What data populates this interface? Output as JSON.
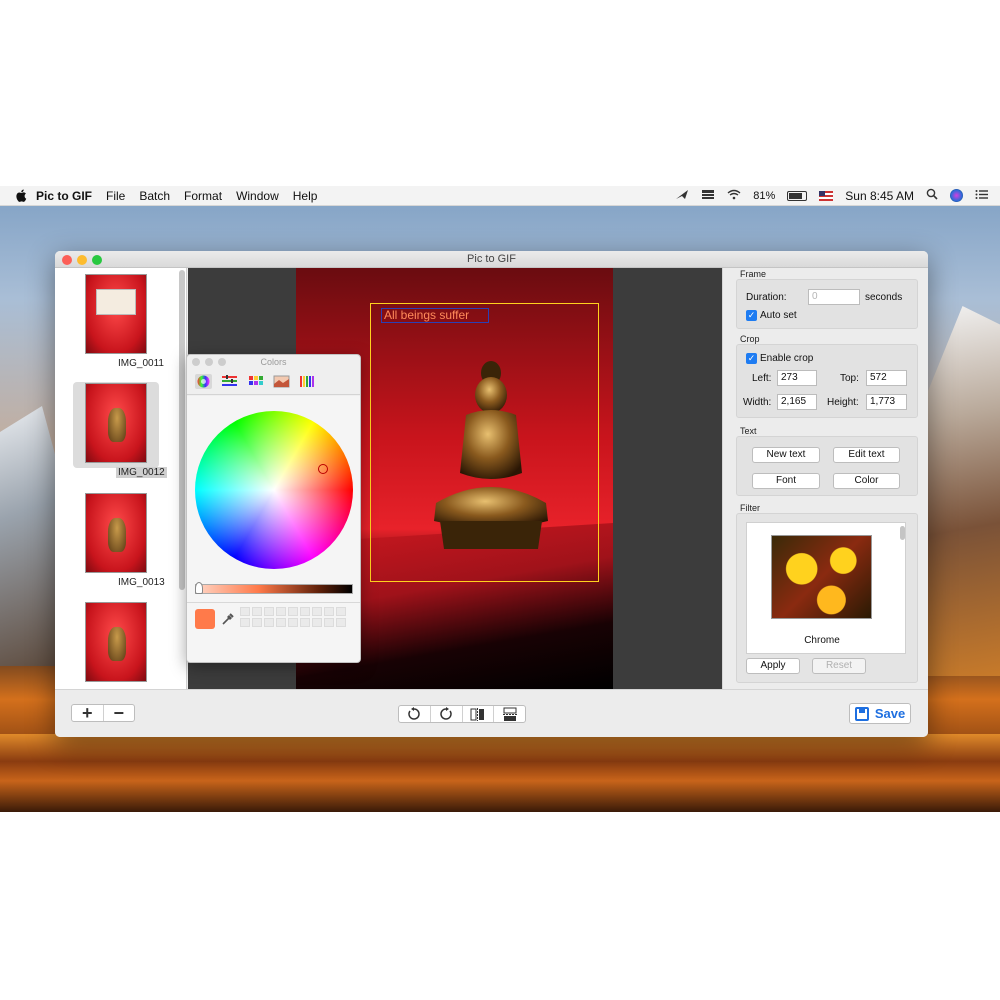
{
  "menubar": {
    "apple_icon": "apple-icon",
    "app_name": "Pic to GIF",
    "items": [
      "File",
      "Batch",
      "Format",
      "Window",
      "Help"
    ],
    "battery_percent": "81%",
    "clock": "Sun 8:45 AM"
  },
  "window": {
    "title": "Pic to GIF"
  },
  "thumbnails": [
    {
      "label": "IMG_0011",
      "selected": false
    },
    {
      "label": "IMG_0012",
      "selected": true
    },
    {
      "label": "IMG_0013",
      "selected": false
    },
    {
      "label": "",
      "selected": false
    }
  ],
  "canvas": {
    "overlay_text": "All beings suffer"
  },
  "colors_panel": {
    "title": "Colors",
    "selected_color": "#ff7a4a"
  },
  "frame": {
    "section_label": "Frame",
    "duration_label": "Duration:",
    "duration_placeholder": "0",
    "duration_unit": "seconds",
    "auto_set_label": "Auto set"
  },
  "crop": {
    "section_label": "Crop",
    "enable_label": "Enable crop",
    "left_label": "Left:",
    "left_value": "273",
    "top_label": "Top:",
    "top_value": "572",
    "width_label": "Width:",
    "width_value": "2,165",
    "height_label": "Height:",
    "height_value": "1,773"
  },
  "text": {
    "section_label": "Text",
    "new_text": "New text",
    "edit_text": "Edit text",
    "font": "Font",
    "color": "Color"
  },
  "filter": {
    "section_label": "Filter",
    "current_filter": "Chrome",
    "apply": "Apply",
    "reset": "Reset"
  },
  "bottom": {
    "add_symbol": "+",
    "remove_symbol": "−",
    "save_label": "Save"
  },
  "colors": {
    "accent": "#1e6fe0",
    "checkbox": "#1e7cf2",
    "crop_border": "#ffd21e"
  }
}
